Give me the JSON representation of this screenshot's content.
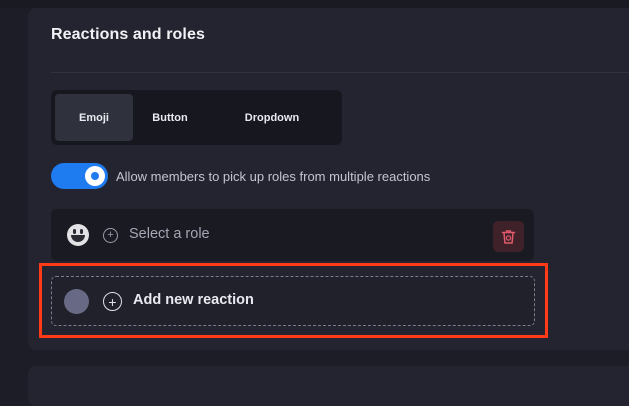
{
  "section": {
    "title": "Reactions and roles"
  },
  "tabs": [
    {
      "label": "Emoji",
      "active": true
    },
    {
      "label": "Button",
      "active": false
    },
    {
      "label": "Dropdown",
      "active": false
    }
  ],
  "toggle": {
    "enabled": true,
    "label": "Allow members to pick up roles from multiple reactions"
  },
  "reaction": {
    "emoji_icon": "grinning-face-icon",
    "role_placeholder": "Select a role",
    "delete_icon": "trash-icon"
  },
  "add_reaction": {
    "label": "Add new reaction",
    "icon": "plus-circle-icon"
  },
  "colors": {
    "accent": "#1f7bf0",
    "highlight": "#ff3a17",
    "delete_bg": "#3e2129",
    "delete_icon": "#e05a6c"
  }
}
